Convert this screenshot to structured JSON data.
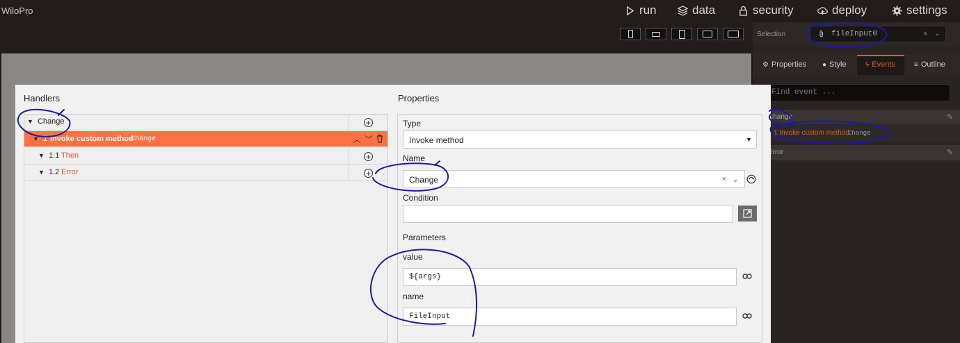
{
  "app": {
    "brand": "WiloPro"
  },
  "nav": [
    {
      "label": "run",
      "icon": "play-icon"
    },
    {
      "label": "data",
      "icon": "database-icon"
    },
    {
      "label": "security",
      "icon": "lock-icon"
    },
    {
      "label": "deploy",
      "icon": "cloud-upload-icon"
    },
    {
      "label": "settings",
      "icon": "gear-icon"
    }
  ],
  "devices": [
    "phone-portrait",
    "phone-landscape",
    "tablet-portrait",
    "tablet-landscape",
    "desktop"
  ],
  "selection": {
    "label": "Selection",
    "value": "fileInput0",
    "clear": "×",
    "chevron": "⌄"
  },
  "panel_tabs": {
    "properties": "Properties",
    "style": "Style",
    "events": "Events",
    "outline": "Outline"
  },
  "find_event": {
    "placeholder": "Find event ..."
  },
  "events_panel": {
    "change": "Change",
    "handler_text": "1 Invoke custom method",
    "handler_code": "Change",
    "error": "Error"
  },
  "dialog": {
    "handlers_title": "Handlers",
    "properties_title": "Properties",
    "tree": {
      "root": "Change",
      "invoke_num": "1",
      "invoke_text": "Invoke custom method",
      "invoke_code": "Change",
      "then_num": "1.1",
      "then_text": "Then",
      "error_num": "1.2",
      "error_text": "Error"
    },
    "props": {
      "type_label": "Type",
      "type_value": "Invoke method",
      "name_label": "Name",
      "name_value": "Change",
      "condition_label": "Condition",
      "condition_value": "",
      "parameters_label": "Parameters",
      "param_value_label": "value",
      "param_value": "${args}",
      "param_name_label": "name",
      "param_name": "FileInput"
    }
  },
  "colors": {
    "accent": "#ff7043",
    "annotation": "#1a1aa8"
  }
}
